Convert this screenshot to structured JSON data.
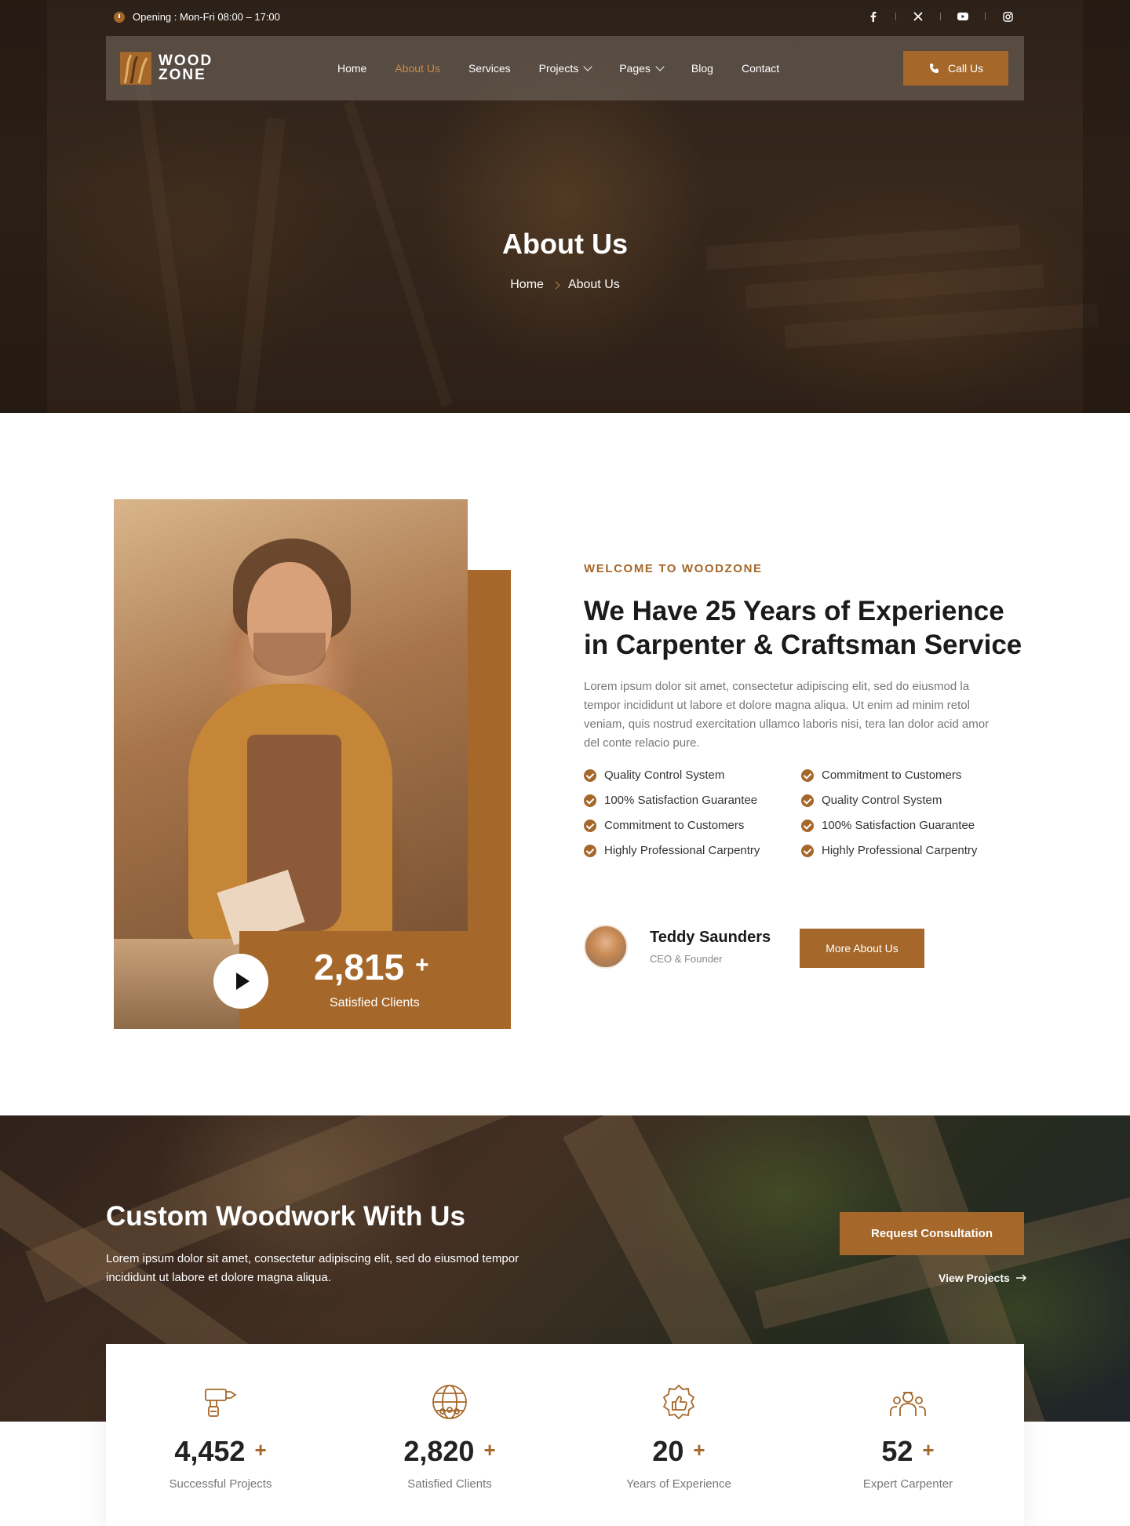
{
  "topbar": {
    "opening": "Opening : Mon-Fri 08:00 – 17:00",
    "socials": [
      "facebook-icon",
      "x-icon",
      "youtube-icon",
      "instagram-icon"
    ]
  },
  "brand": {
    "line1": "WOOD",
    "line2": "ZONE"
  },
  "nav": {
    "home": "Home",
    "about": "About Us",
    "services": "Services",
    "projects": "Projects",
    "pages": "Pages",
    "blog": "Blog",
    "contact": "Contact",
    "call": "Call Us"
  },
  "hero": {
    "title": "About Us",
    "crumb_home": "Home",
    "crumb_current": "About Us"
  },
  "about": {
    "eyebrow": "WELCOME TO WOODZONE",
    "title_line1": "We Have 25 Years of Experience",
    "title_line2": "in Carpenter & Craftsman Service",
    "desc": "Lorem ipsum dolor sit amet, consectetur adipiscing elit, sed do eiusmod la tempor incididunt ut labore et dolore magna aliqua. Ut enim ad minim retol veniam, quis nostrud exercitation ullamco laboris nisi, tera lan dolor acid amor del conte relacio pure.",
    "checks": [
      "Quality Control System",
      "Commitment to Customers",
      "100% Satisfaction Guarantee",
      "Quality Control System",
      "Commitment to Customers",
      "100% Satisfaction Guarantee",
      "Highly Professional Carpentry",
      "Highly Professional Carpentry"
    ],
    "clients_value": "2,815",
    "clients_plus": "+",
    "clients_label": "Satisfied Clients",
    "founder_name": "Teddy Saunders",
    "founder_role": "CEO & Founder",
    "more_button": "More About Us"
  },
  "cta": {
    "title": "Custom Woodwork With Us",
    "desc": "Lorem ipsum dolor sit amet, consectetur adipiscing elit, sed do eiusmod tempor incididunt ut labore et dolore magna aliqua.",
    "button": "Request Consultation",
    "link": "View Projects"
  },
  "stats": [
    {
      "icon": "drill-icon",
      "value": "4,452",
      "plus": "+",
      "label": "Successful Projects"
    },
    {
      "icon": "globe-users-icon",
      "value": "2,820",
      "plus": "+",
      "label": "Satisfied Clients"
    },
    {
      "icon": "badge-thumbs-up-icon",
      "value": "20",
      "plus": "+",
      "label": "Years of Experience"
    },
    {
      "icon": "team-icon",
      "value": "52",
      "plus": "+",
      "label": "Expert Carpenter"
    }
  ],
  "colors": {
    "accent": "#a5672a",
    "dark": "#1a1a1a",
    "muted": "#777777"
  }
}
